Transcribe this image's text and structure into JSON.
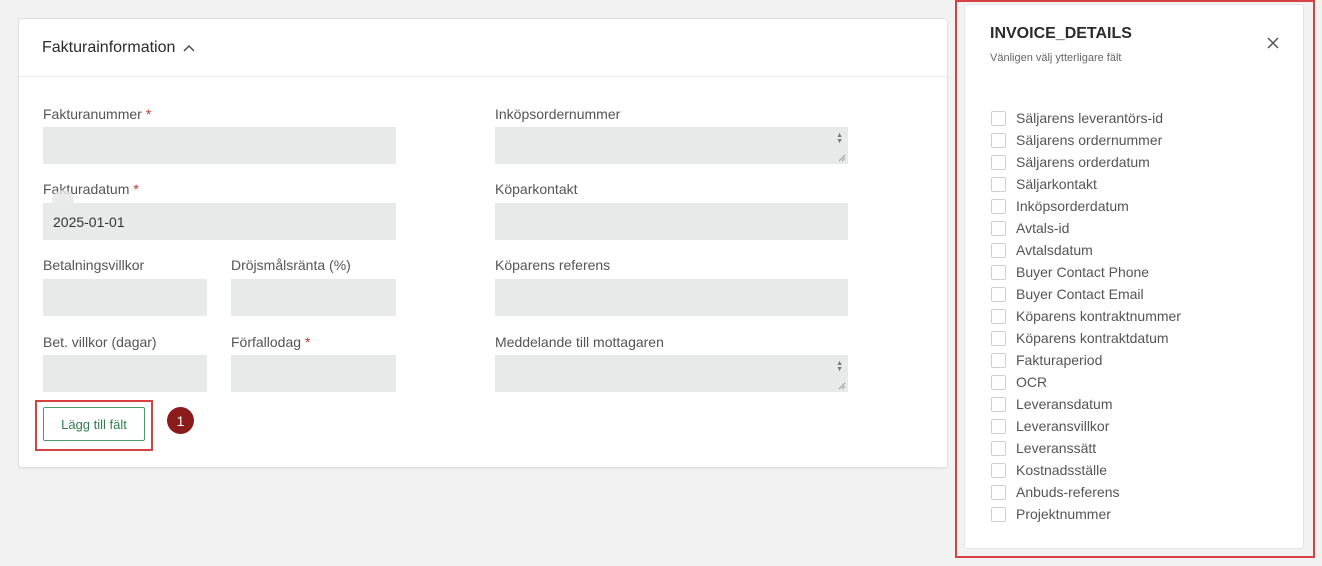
{
  "section": {
    "title": "Fakturainformation"
  },
  "fields": {
    "invoice_number": {
      "label": "Fakturanummer",
      "required": "*",
      "value": ""
    },
    "purchase_order_number": {
      "label": "Inköpsordernummer",
      "value": ""
    },
    "invoice_date": {
      "label": "Fakturadatum",
      "required": "*",
      "value": "2025-01-01"
    },
    "buyer_contact": {
      "label": "Köparkontakt",
      "value": ""
    },
    "payment_terms": {
      "label": "Betalningsvillkor",
      "value": ""
    },
    "late_interest": {
      "label": "Dröjsmålsränta (%)",
      "value": ""
    },
    "buyer_reference": {
      "label": "Köparens referens",
      "value": ""
    },
    "payment_terms_days": {
      "label": "Bet. villkor (dagar)",
      "value": ""
    },
    "due_date": {
      "label": "Förfallodag",
      "required": "*",
      "value": ""
    },
    "message_to_recipient": {
      "label": "Meddelande till mottagaren",
      "value": ""
    }
  },
  "add_field_button": {
    "label": "Lägg till fält"
  },
  "step_badge": "1",
  "panel": {
    "title": "INVOICE_DETAILS",
    "subtitle": "Vänligen välj ytterligare fält",
    "options": [
      "Säljarens leverantörs-id",
      "Säljarens ordernummer",
      "Säljarens orderdatum",
      "Säljarkontakt",
      "Inköpsorderdatum",
      "Avtals-id",
      "Avtalsdatum",
      "Buyer Contact Phone",
      "Buyer Contact Email",
      "Köparens kontraktnummer",
      "Köparens kontraktdatum",
      "Fakturaperiod",
      "OCR",
      "Leveransdatum",
      "Leveransvillkor",
      "Leveranssätt",
      "Kostnadsställe",
      "Anbuds-referens",
      "Projektnummer"
    ]
  },
  "colors": {
    "accent_green": "#4c9a6a",
    "highlight_red": "#d94040",
    "badge": "#8b1a1a",
    "required": "#c0392b",
    "input_bg": "#e8eaea"
  }
}
